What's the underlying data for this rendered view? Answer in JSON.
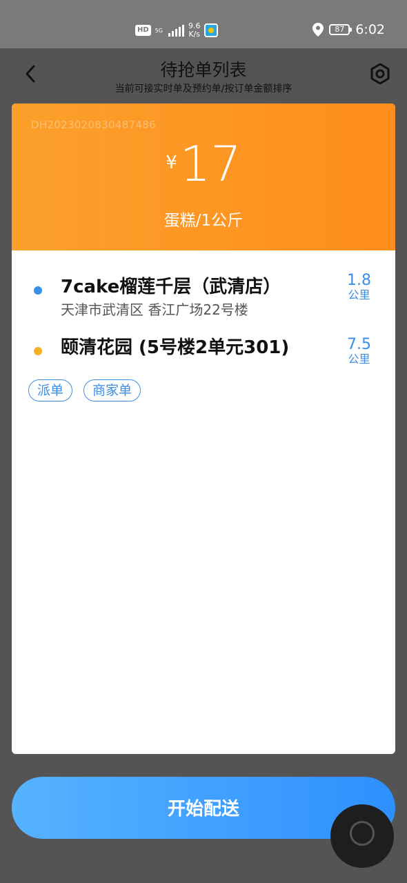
{
  "status_bar": {
    "hd": "HD",
    "network": "5G",
    "speed_value": "9.6",
    "speed_unit": "K/s",
    "battery": "87",
    "time": "6:02"
  },
  "header": {
    "title": "待抢单列表",
    "subtitle": "当前可接实时单及预约单/按订单金额排序"
  },
  "order": {
    "order_no": "DH202302083048748​6",
    "currency": "¥",
    "price": "17",
    "goods": "蛋糕/1公斤",
    "pickup": {
      "name": "7cake榴莲千层（武清店）",
      "address": "天津市武清区 香江广场22号楼",
      "distance": "1.8",
      "unit": "公里",
      "dot_color": "#3a8ee6"
    },
    "dropoff": {
      "name": "颐清花园 (5号楼2单元301)",
      "distance": "7.5",
      "unit": "公里",
      "dot_color": "#f5b324"
    },
    "tags": [
      "派单",
      "商家单"
    ]
  },
  "actions": {
    "start_label": "开始配送"
  },
  "colors": {
    "card_top": "#ff9320",
    "accent_blue": "#3a8ee6",
    "button_blue": "#3d9dff"
  }
}
